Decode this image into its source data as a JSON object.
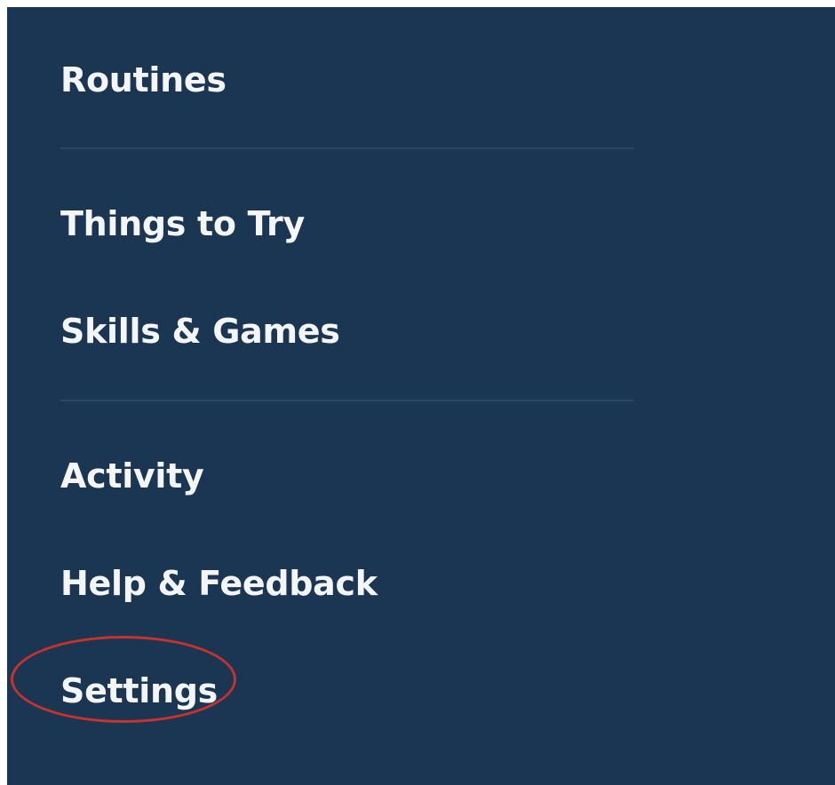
{
  "menu": {
    "items": [
      {
        "id": "routines",
        "label": "Routines"
      },
      {
        "id": "things-to-try",
        "label": "Things to Try"
      },
      {
        "id": "skills-games",
        "label": "Skills & Games"
      },
      {
        "id": "activity",
        "label": "Activity"
      },
      {
        "id": "help-feedback",
        "label": "Help & Feedback"
      },
      {
        "id": "settings",
        "label": "Settings"
      }
    ]
  },
  "colors": {
    "panel_background": "#1a3652",
    "text": "#f3f5f7",
    "divider": "#284863",
    "highlight_ring": "#c8322c"
  },
  "annotation": {
    "highlighted_item": "settings",
    "shape": "ellipse"
  }
}
